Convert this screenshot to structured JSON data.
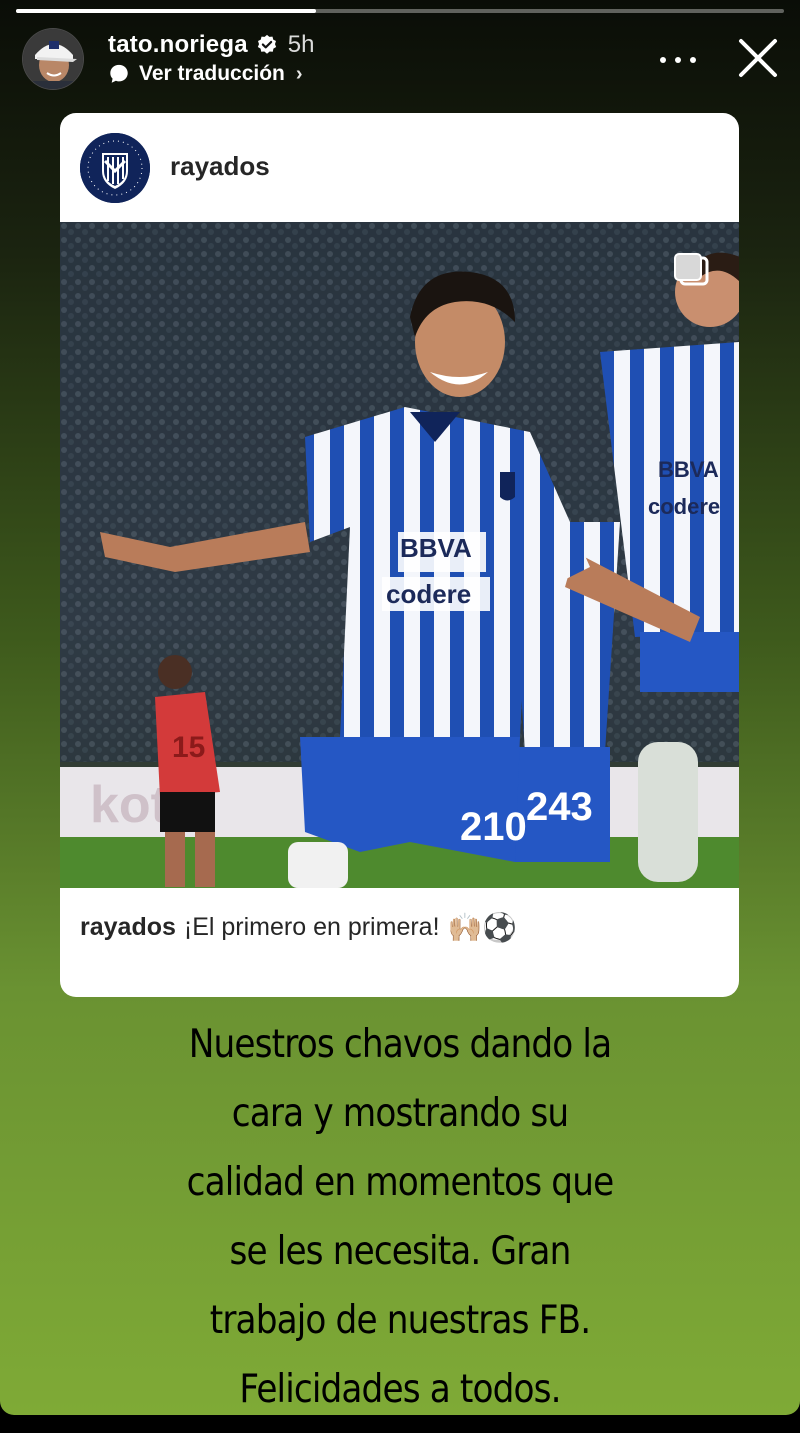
{
  "story": {
    "progress_fraction": 0.39,
    "username": "tato.noriega",
    "time_ago": "5h",
    "translate_label": "Ver traducción",
    "translate_chevron": "›",
    "more_icon": "more-horizontal-icon",
    "close_icon": "close-icon"
  },
  "repost": {
    "account": "rayados",
    "caption_user": "rayados",
    "caption_text": "¡El primero en primera!",
    "caption_emoji": "🙌🏼⚽",
    "photo_texts": {
      "sponsor_1": "BBVA",
      "sponsor_2": "codere",
      "number_main": "210",
      "number_second": "243",
      "rival_number": "15",
      "sponsor_right_1": "BBVA",
      "sponsor_right_2": "codere"
    }
  },
  "story_text": {
    "lines": [
      "Nuestros chavos dando la",
      "cara y mostrando su",
      "calidad en momentos que",
      "se les necesita. Gran",
      "trabajo de nuestras FB.",
      "Felicidades a todos."
    ]
  },
  "colors": {
    "background_top": "#0a0d07",
    "background_bottom": "#7faa36",
    "club_navy": "#10245a",
    "kit_blue": "#1f4fb3",
    "rival_red": "#d33a3a"
  }
}
